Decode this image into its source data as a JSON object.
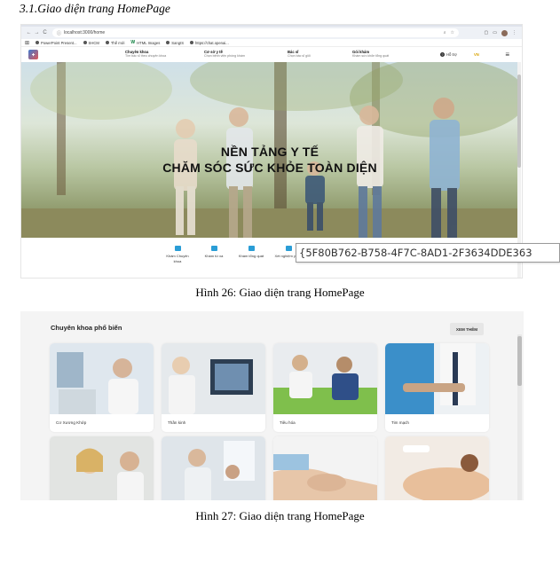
{
  "document": {
    "section_heading": "3.1.Giao diện trang HomePage",
    "caption_1": "Hình 26: Giao diện trang HomePage",
    "caption_2": "Hình 27: Giao diện trang HomePage"
  },
  "browser": {
    "back": "←",
    "forward": "→",
    "reload": "C",
    "url": "localhost:3000/home",
    "bookmarks_grid_icon": "grid-icon",
    "bookmarks": [
      "PowerPoint Present...",
      "SHCM",
      "Thế mới",
      "HTML Images",
      "SangIS",
      "https://chat.openai..."
    ]
  },
  "site": {
    "menu": [
      {
        "title": "Chuyên khoa",
        "subtitle": "Tìm bác sĩ theo chuyên khoa"
      },
      {
        "title": "Cơ sở y tế",
        "subtitle": "Chọn bệnh viện phòng khám"
      },
      {
        "title": "Bác sĩ",
        "subtitle": "Chọn bác sĩ giỏi"
      },
      {
        "title": "Gói khám",
        "subtitle": "Khám sức khỏe tổng quát"
      }
    ],
    "help_label": "Hỗ trợ",
    "cta_label": "VN",
    "hero_line_1": "NỀN TẢNG Y TẾ",
    "hero_line_2": "CHĂM SÓC SỨC KHỎE TOÀN DIỆN",
    "services": [
      "Khám Chuyên khoa",
      "Khám từ xa",
      "Khám tổng quát",
      "Xét nghiệm y học"
    ]
  },
  "tooltip_text": "{5F80B762-B758-4F7C-8AD1-2F3634DDE363",
  "specialties": {
    "title": "Chuyên khoa phổ biến",
    "see_more": "XEM THÊM",
    "items": [
      "Cơ Xương Khớp",
      "Thần kinh",
      "Tiêu hóa",
      "Tim mạch",
      "",
      "",
      "",
      ""
    ]
  },
  "colors": {
    "accent": "#2a9dd6",
    "cta": "#d9a300",
    "hero_text": "#111111"
  }
}
